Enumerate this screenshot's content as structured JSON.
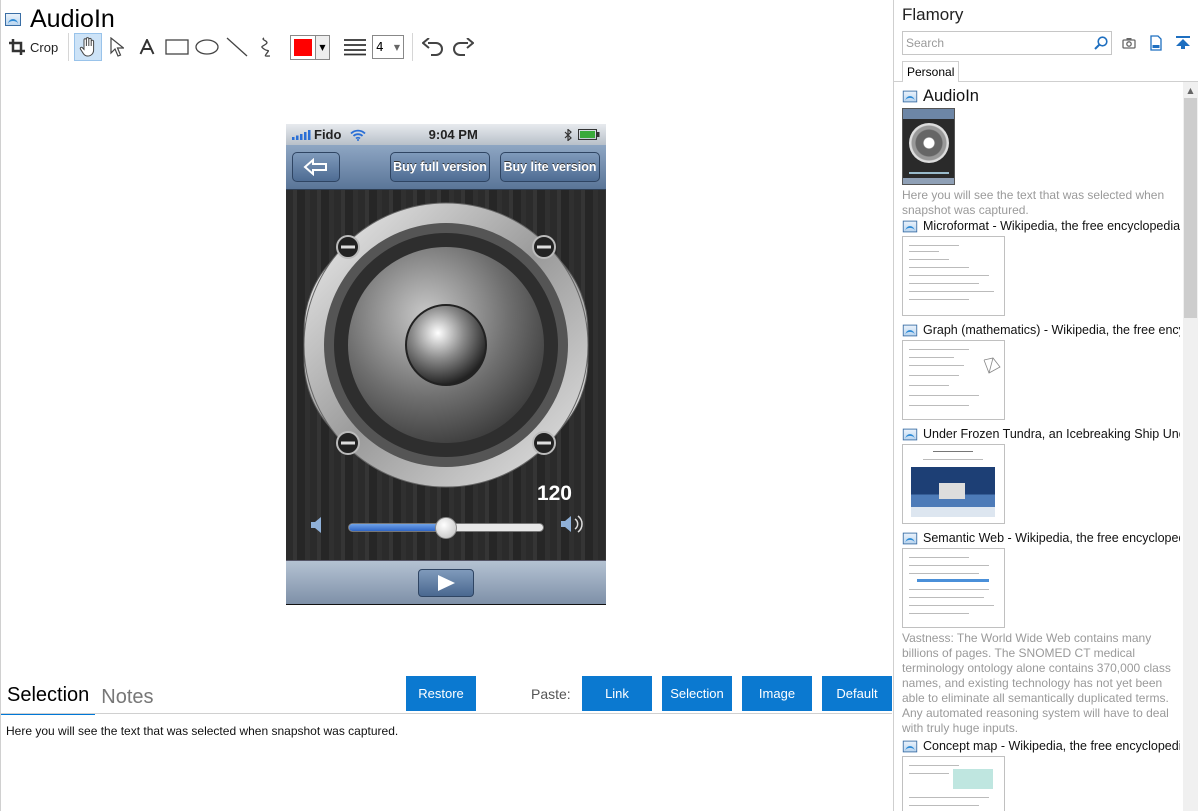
{
  "document": {
    "title": "AudioIn"
  },
  "toolbar": {
    "crop_label": "Crop",
    "line_width": "4"
  },
  "colors": {
    "accent": "#0b79d0",
    "draw_color": "#ff0000"
  },
  "phone": {
    "carrier": "Fido",
    "time": "9:04 PM",
    "buttons": {
      "buy_full": "Buy full version",
      "buy_lite": "Buy lite version"
    },
    "volume_value": "120",
    "volume_fraction": 0.5
  },
  "notes": {
    "tabs": [
      "Selection",
      "Notes"
    ],
    "restore_label": "Restore",
    "paste_label": "Paste:",
    "paste_buttons": [
      "Link",
      "Selection",
      "Image",
      "Default"
    ],
    "selection_text": "Here you will see the text that was selected when snapshot was captured."
  },
  "sidebar": {
    "app_title": "Flamory",
    "search_placeholder": "Search",
    "tab": "Personal",
    "items": [
      {
        "title": "AudioIn",
        "desc": "Here you will see the text that was selected when snapshot was captured."
      },
      {
        "title": "Microformat - Wikipedia, the free encyclopedia"
      },
      {
        "title": "Graph (mathematics) - Wikipedia, the free encyclopedia"
      },
      {
        "title": "Under Frozen Tundra, an Icebreaking Ship Uncovers"
      },
      {
        "title": "Semantic Web - Wikipedia, the free encyclopedia",
        "desc": "Vastness: The World Wide Web contains many billions of pages. The SNOMED CT medical terminology ontology alone contains 370,000 class names, and existing technology has not yet been able to eliminate all semantically duplicated terms. Any automated reasoning system will have to deal with truly huge inputs."
      },
      {
        "title": "Concept map - Wikipedia, the free encyclopedia"
      }
    ]
  }
}
